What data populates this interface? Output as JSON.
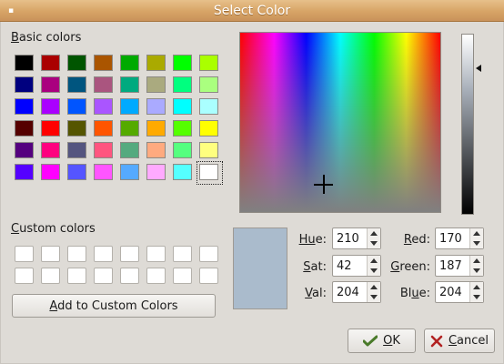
{
  "window": {
    "title": "Select Color",
    "menu_glyph": "▪"
  },
  "basic_colors": {
    "label_u": "B",
    "label_rest": "asic colors",
    "selected_index": 47,
    "swatches": [
      "#000000",
      "#aa0000",
      "#005500",
      "#aa5500",
      "#00aa00",
      "#aaaa00",
      "#00ff00",
      "#aaff00",
      "#00007f",
      "#aa007f",
      "#00557f",
      "#aa557f",
      "#00aa7f",
      "#aaaa7f",
      "#00ff7f",
      "#aaff7f",
      "#0000ff",
      "#aa00ff",
      "#0055ff",
      "#aa55ff",
      "#00aaff",
      "#aaaaff",
      "#00ffff",
      "#aaffff",
      "#550000",
      "#ff0000",
      "#555500",
      "#ff5500",
      "#55aa00",
      "#ffaa00",
      "#55ff00",
      "#ffff00",
      "#55007f",
      "#ff007f",
      "#55557f",
      "#ff557f",
      "#55aa7f",
      "#ffaa7f",
      "#55ff7f",
      "#ffff7f",
      "#5500ff",
      "#ff00ff",
      "#5555ff",
      "#ff55ff",
      "#55aaff",
      "#ffaaff",
      "#55ffff",
      "#ffffff"
    ]
  },
  "custom_colors": {
    "label_u": "C",
    "label_rest": "ustom colors",
    "count": 16,
    "add_button_u": "A",
    "add_button_rest": "dd to Custom Colors"
  },
  "current_color": "#aabbcc",
  "hsv": {
    "hue": {
      "u": "Hu",
      "rest": "e:",
      "pre": "",
      "value": "210"
    },
    "sat": {
      "u": "S",
      "rest": "at:",
      "pre": "",
      "value": "42"
    },
    "val": {
      "u": "V",
      "rest": "al:",
      "pre": "",
      "value": "204"
    }
  },
  "rgb": {
    "red": {
      "pre": "",
      "u": "R",
      "rest": "ed:",
      "value": "170"
    },
    "green": {
      "pre": "",
      "u": "G",
      "rest": "reen:",
      "value": "187"
    },
    "blue": {
      "pre": "Bl",
      "u": "u",
      "rest": "e:",
      "value": "204"
    }
  },
  "buttons": {
    "ok": {
      "u": "O",
      "rest": "K",
      "icon": "ok-check-icon"
    },
    "cancel": {
      "u": "C",
      "rest": "ancel",
      "icon": "cancel-x-icon"
    }
  }
}
